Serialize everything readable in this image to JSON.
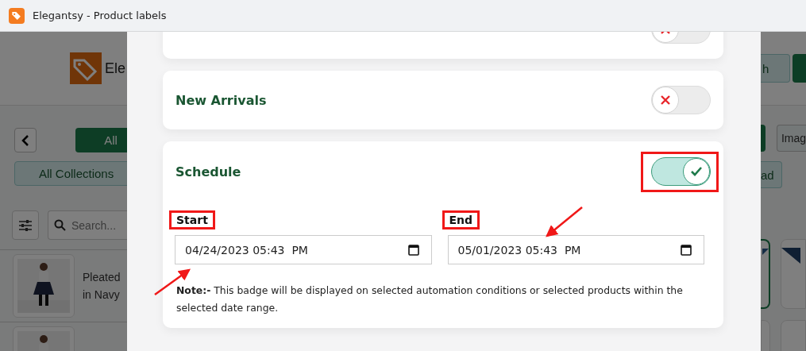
{
  "window": {
    "title": "Elegantsy - Product labels"
  },
  "background_left": {
    "brand_text": "Ele",
    "all_button": "All",
    "collection_tag": "All Collections",
    "search": {
      "placeholder": "Search..."
    },
    "products": [
      {
        "kind": "picture",
        "lines": [
          "Pleated",
          "in Navy"
        ]
      },
      {
        "kind": "picture"
      }
    ]
  },
  "background_right": {
    "header_button": "h",
    "filter_button": "Imag",
    "tag_button": "ad"
  },
  "modal": {
    "settings": [
      {
        "kind": "partial",
        "on": false
      },
      {
        "kind": "toggle",
        "label": "New Arrivals",
        "on": false
      },
      {
        "kind": "schedule",
        "label": "Schedule",
        "on": true,
        "start": {
          "label": "Start",
          "value": "04/24/2023 05:43  PM"
        },
        "end": {
          "label": "End",
          "value": "05/01/2023 05:43  PM"
        },
        "note": "**Note:-** This badge will be displayed on selected automation conditions or selected products within the selected date range."
      }
    ]
  }
}
